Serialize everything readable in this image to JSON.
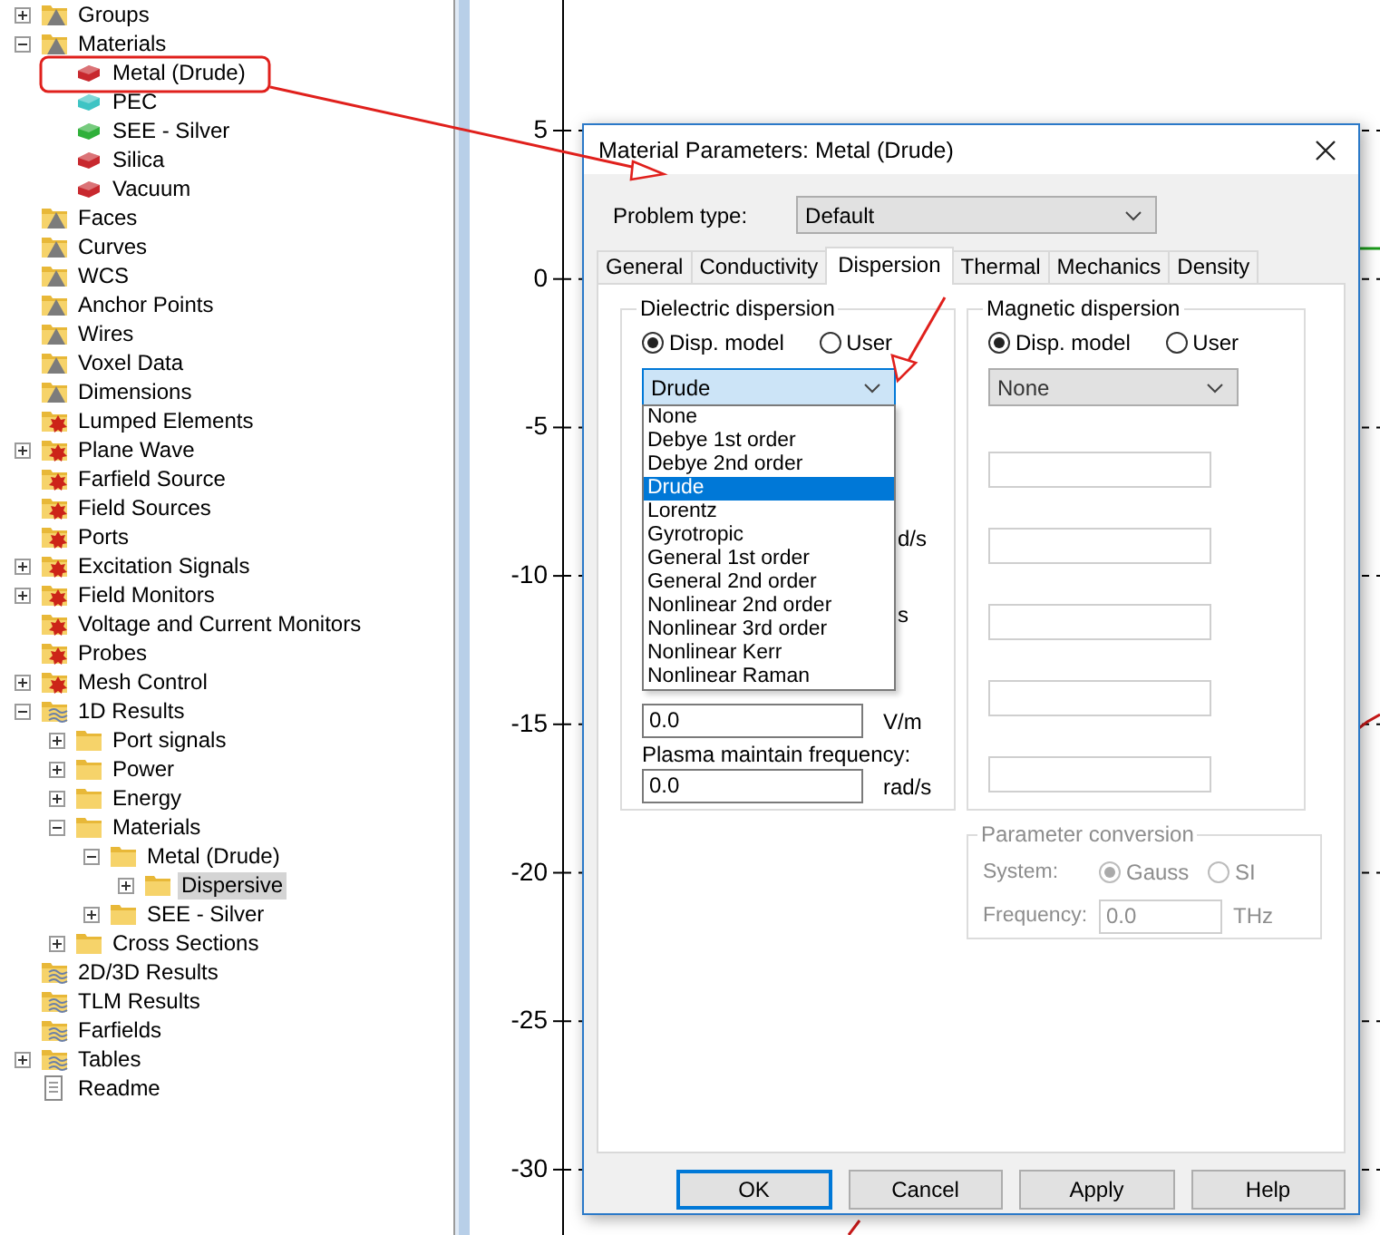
{
  "tree": [
    {
      "label": "Groups",
      "kind": "shape-folder",
      "expanded": false,
      "selected": false
    },
    {
      "label": "Materials",
      "kind": "shape-folder",
      "expanded": true,
      "selected": false,
      "children": [
        {
          "label": "Metal (Drude)",
          "kind": "material",
          "color": "#c8282e",
          "selected": false
        },
        {
          "label": "PEC",
          "kind": "material",
          "color": "#3ec4c4",
          "selected": false
        },
        {
          "label": "SEE - Silver",
          "kind": "material",
          "color": "#2fb03a",
          "selected": false
        },
        {
          "label": "Silica",
          "kind": "material",
          "color": "#c8282e",
          "selected": false
        },
        {
          "label": "Vacuum",
          "kind": "material",
          "color": "#c8282e",
          "selected": false
        }
      ]
    },
    {
      "label": "Faces",
      "kind": "shape-folder",
      "selected": false
    },
    {
      "label": "Curves",
      "kind": "shape-folder",
      "selected": false
    },
    {
      "label": "WCS",
      "kind": "shape-folder",
      "selected": false
    },
    {
      "label": "Anchor Points",
      "kind": "shape-folder",
      "selected": false
    },
    {
      "label": "Wires",
      "kind": "shape-folder",
      "selected": false
    },
    {
      "label": "Voxel Data",
      "kind": "shape-folder",
      "selected": false
    },
    {
      "label": "Dimensions",
      "kind": "shape-folder",
      "selected": false
    },
    {
      "label": "Lumped Elements",
      "kind": "source-folder",
      "selected": false
    },
    {
      "label": "Plane Wave",
      "kind": "source-folder",
      "expanded": false,
      "selected": false
    },
    {
      "label": "Farfield Source",
      "kind": "source-folder",
      "selected": false
    },
    {
      "label": "Field Sources",
      "kind": "source-folder",
      "selected": false
    },
    {
      "label": "Ports",
      "kind": "source-folder",
      "selected": false
    },
    {
      "label": "Excitation Signals",
      "kind": "source-folder",
      "expanded": false,
      "selected": false
    },
    {
      "label": "Field Monitors",
      "kind": "source-folder",
      "expanded": false,
      "selected": false
    },
    {
      "label": "Voltage and Current Monitors",
      "kind": "source-folder",
      "selected": false
    },
    {
      "label": "Probes",
      "kind": "source-folder",
      "selected": false
    },
    {
      "label": "Mesh Control",
      "kind": "source-folder",
      "expanded": false,
      "selected": false
    },
    {
      "label": "1D Results",
      "kind": "result-folder",
      "expanded": true,
      "selected": false,
      "children": [
        {
          "label": "Port signals",
          "kind": "folder",
          "expanded": false,
          "selected": false
        },
        {
          "label": "Power",
          "kind": "folder",
          "expanded": false,
          "selected": false
        },
        {
          "label": "Energy",
          "kind": "folder",
          "expanded": false,
          "selected": false
        },
        {
          "label": "Materials",
          "kind": "folder",
          "expanded": true,
          "selected": false,
          "children": [
            {
              "label": "Metal (Drude)",
              "kind": "folder",
              "expanded": true,
              "selected": false,
              "children": [
                {
                  "label": "Dispersive",
                  "kind": "folder",
                  "expanded": false,
                  "selected": true
                }
              ]
            },
            {
              "label": "SEE - Silver",
              "kind": "folder",
              "expanded": false,
              "selected": false
            }
          ]
        },
        {
          "label": "Cross Sections",
          "kind": "folder",
          "expanded": false,
          "selected": false
        }
      ]
    },
    {
      "label": "2D/3D Results",
      "kind": "result-folder",
      "selected": false
    },
    {
      "label": "TLM Results",
      "kind": "result-folder",
      "selected": false
    },
    {
      "label": "Farfields",
      "kind": "result-folder",
      "selected": false
    },
    {
      "label": "Tables",
      "kind": "result-folder",
      "expanded": false,
      "selected": false
    },
    {
      "label": "Readme",
      "kind": "document",
      "selected": false
    }
  ],
  "plot": {
    "y_axis_labels": [
      "5",
      "0",
      "-5",
      "-10",
      "-15",
      "-20",
      "-25",
      "-30"
    ]
  },
  "dialog": {
    "title": "Material Parameters: Metal (Drude)",
    "problem_type": {
      "label": "Problem type:",
      "value": "Default"
    },
    "tabs": [
      {
        "label": "General",
        "selected": false
      },
      {
        "label": "Conductivity",
        "selected": false
      },
      {
        "label": "Dispersion",
        "selected": true
      },
      {
        "label": "Thermal",
        "selected": false
      },
      {
        "label": "Mechanics",
        "selected": false
      },
      {
        "label": "Density",
        "selected": false
      }
    ],
    "dielectric": {
      "title": "Dielectric dispersion",
      "radios": [
        {
          "label": "Disp. model",
          "selected": true
        },
        {
          "label": "User",
          "selected": false
        }
      ],
      "model": {
        "value": "Drude",
        "expanded": true,
        "options": [
          {
            "label": "None",
            "selected": false
          },
          {
            "label": "Debye 1st order",
            "selected": false
          },
          {
            "label": "Debye 2nd order",
            "selected": false
          },
          {
            "label": "Drude",
            "selected": true
          },
          {
            "label": "Lorentz",
            "selected": false
          },
          {
            "label": "Gyrotropic",
            "selected": false
          },
          {
            "label": "General 1st order",
            "selected": false
          },
          {
            "label": "General 2nd order",
            "selected": false
          },
          {
            "label": "Nonlinear 2nd order",
            "selected": false
          },
          {
            "label": "Nonlinear 3rd order",
            "selected": false
          },
          {
            "label": "Nonlinear Kerr",
            "selected": false
          },
          {
            "label": "Nonlinear Raman",
            "selected": false
          }
        ]
      },
      "units": [
        "d/s",
        "s"
      ],
      "field": {
        "value": "0.0",
        "unit": "V/m"
      },
      "plasma": {
        "label": "Plasma maintain frequency:",
        "value": "0.0",
        "unit": "rad/s"
      }
    },
    "magnetic": {
      "title": "Magnetic dispersion",
      "radios": [
        {
          "label": "Disp. model",
          "selected": true
        },
        {
          "label": "User",
          "selected": false
        }
      ],
      "model": {
        "value": "None",
        "expanded": false
      }
    },
    "conversion": {
      "title": "Parameter conversion",
      "disabled": true,
      "system_label": "System:",
      "radios": [
        {
          "label": "Gauss",
          "selected": true
        },
        {
          "label": "SI",
          "selected": false
        }
      ],
      "frequency_label": "Frequency:",
      "frequency": "0.0",
      "unit": "THz"
    },
    "buttons": [
      {
        "label": "OK",
        "focused": true
      },
      {
        "label": "Cancel",
        "focused": false
      },
      {
        "label": "Apply",
        "focused": false
      },
      {
        "label": "Help",
        "focused": false
      }
    ]
  }
}
